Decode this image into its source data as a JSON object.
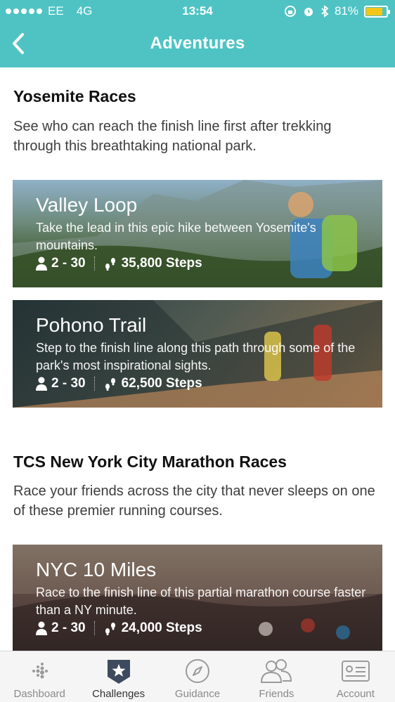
{
  "status_bar": {
    "carrier": "EE",
    "network": "4G",
    "time": "13:54",
    "battery": "81%",
    "battery_level": 0.81
  },
  "header": {
    "title": "Adventures"
  },
  "sections": [
    {
      "title": "Yosemite Races",
      "description": "See who can reach the finish line first after trekking through this breathtaking national park.",
      "cards": [
        {
          "title": "Valley Loop",
          "description": "Take the lead in this epic hike between Yosemite's mountains.",
          "participants": "2 - 30",
          "steps": "35,800 Steps"
        },
        {
          "title": "Pohono Trail",
          "description": "Step to the finish line along this path through some of the park's most inspirational sights.",
          "participants": "2 - 30",
          "steps": "62,500 Steps"
        }
      ]
    },
    {
      "title": "TCS New York City Marathon Races",
      "description": "Race your friends across the city that never sleeps on one of these premier running courses.",
      "cards": [
        {
          "title": "NYC 10 Miles",
          "description": "Race to the finish line of this partial marathon course faster than a NY minute.",
          "participants": "2 - 30",
          "steps": "24,000 Steps"
        }
      ]
    }
  ],
  "tabs": [
    {
      "label": "Dashboard",
      "icon": "dashboard-icon"
    },
    {
      "label": "Challenges",
      "icon": "star-icon",
      "active": true
    },
    {
      "label": "Guidance",
      "icon": "compass-icon"
    },
    {
      "label": "Friends",
      "icon": "friends-icon"
    },
    {
      "label": "Account",
      "icon": "account-card-icon"
    }
  ]
}
